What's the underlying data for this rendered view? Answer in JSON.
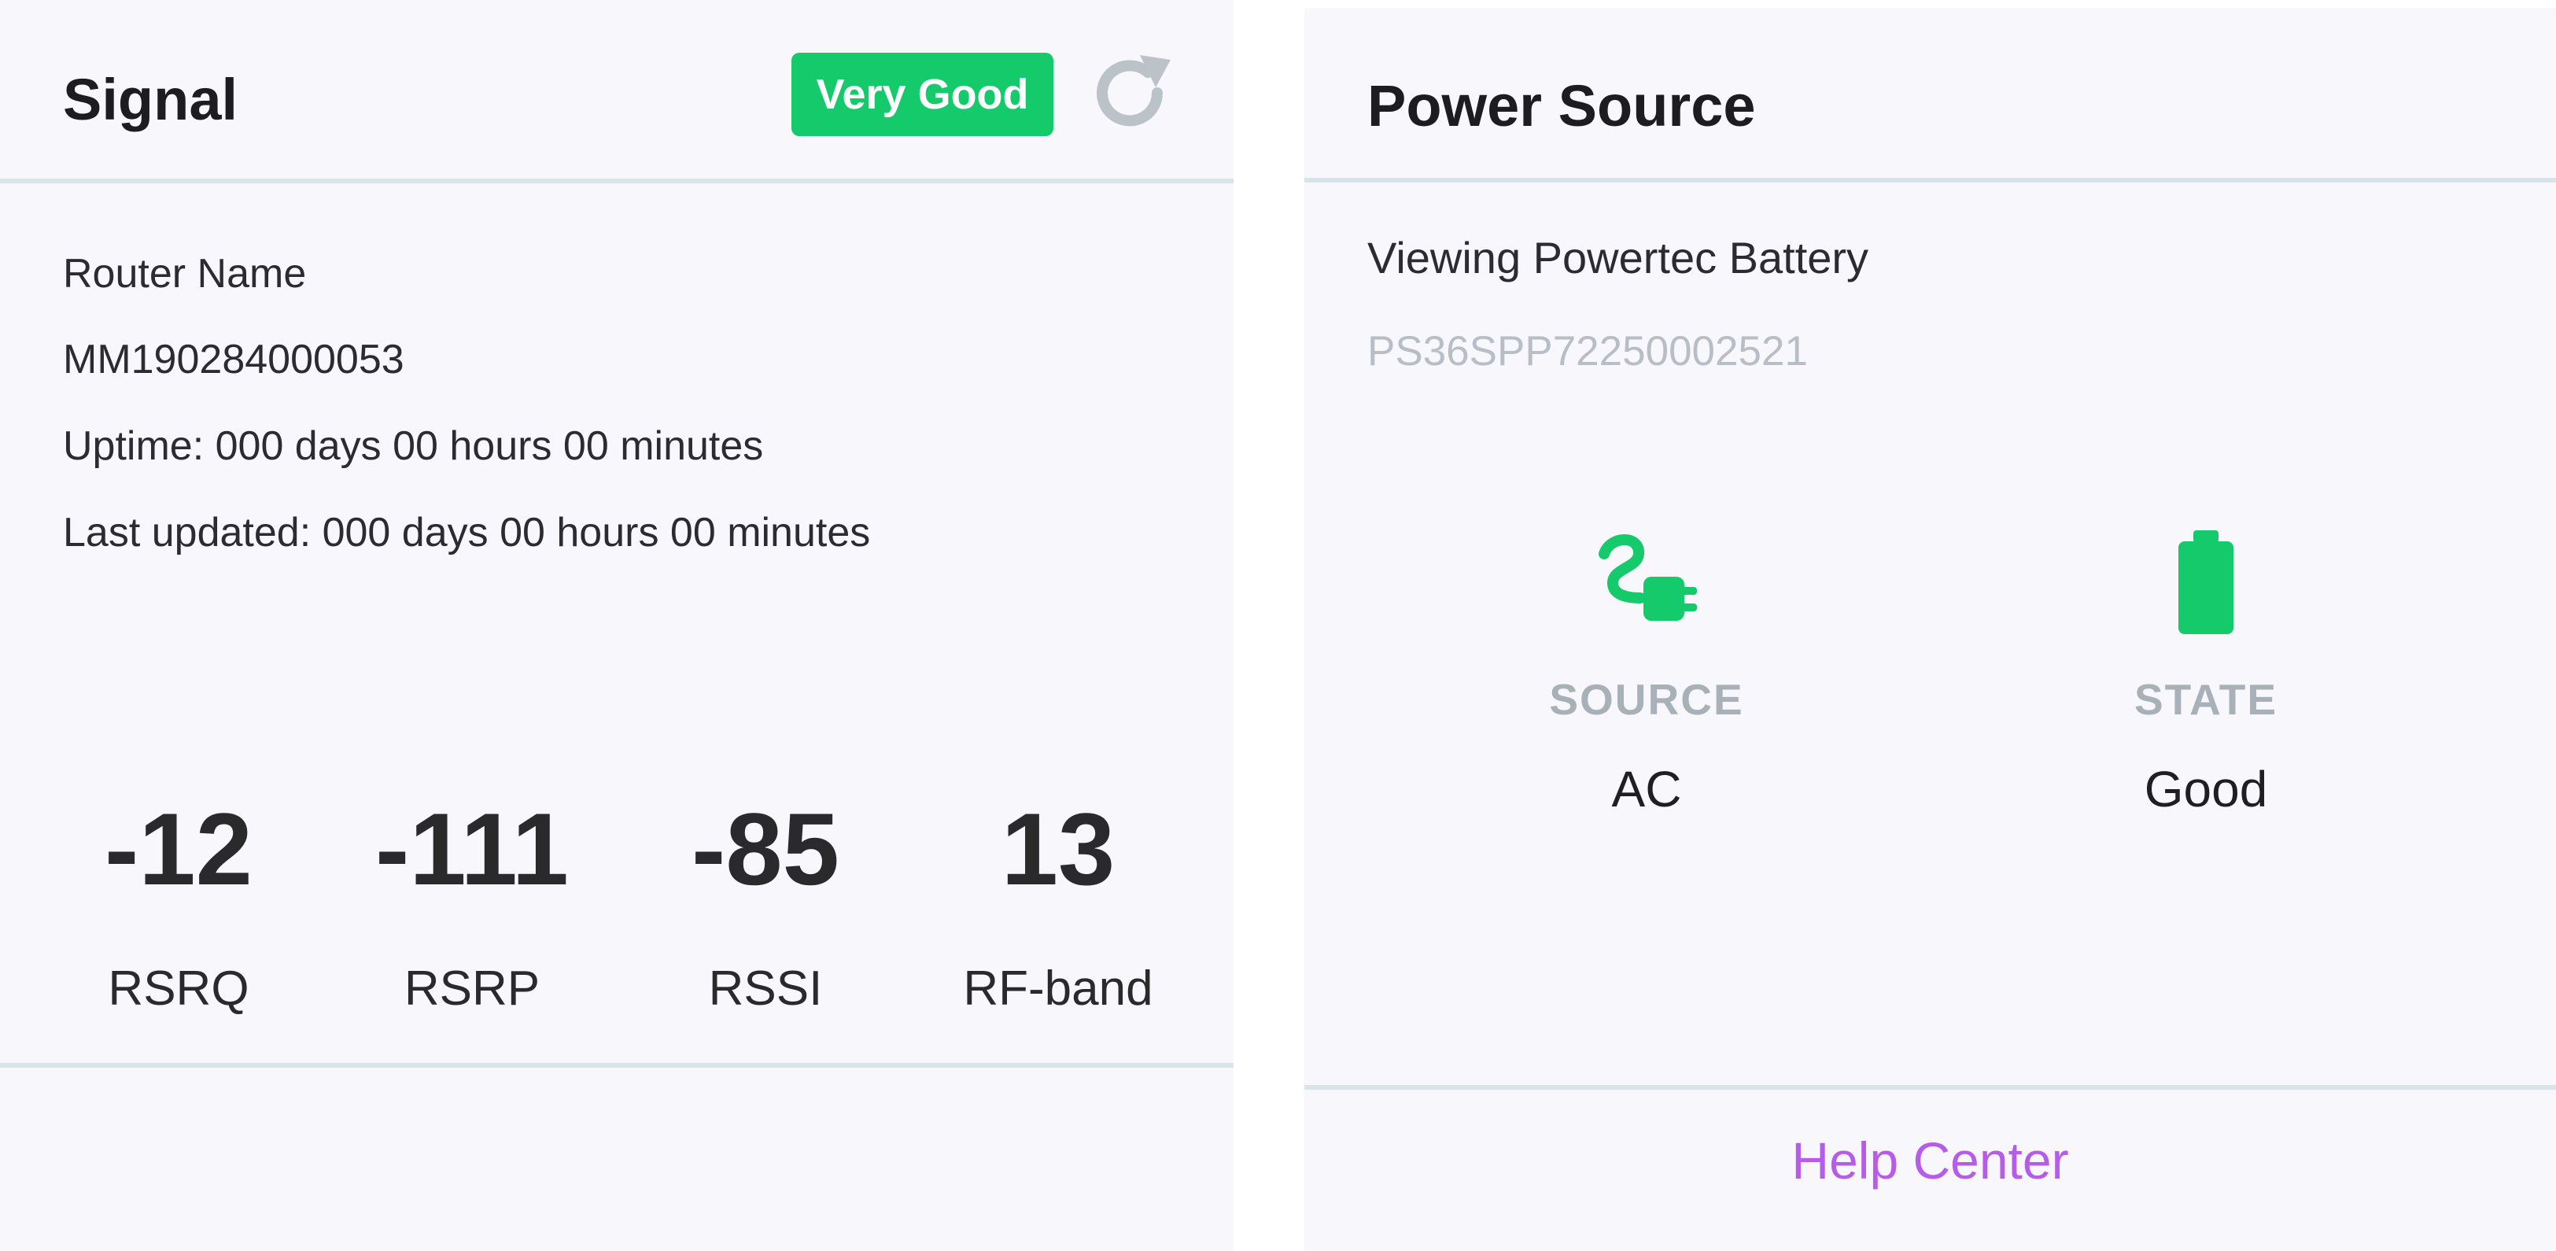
{
  "signal": {
    "title": "Signal",
    "badge": "Very Good",
    "router_name_label": "Router Name",
    "router_id": "MM190284000053",
    "uptime": "Uptime: 000 days 00 hours 00 minutes",
    "last_updated": "Last updated: 000 days 00 hours 00 minutes",
    "metrics": [
      {
        "value": "-12",
        "label": "RSRQ"
      },
      {
        "value": "-111",
        "label": "RSRP"
      },
      {
        "value": "-85",
        "label": "RSSI"
      },
      {
        "value": "13",
        "label": "RF-band"
      }
    ],
    "refresh_icon": "refresh-icon"
  },
  "power": {
    "title": "Power Source",
    "viewing": "Viewing Powertec Battery",
    "serial": "PS36SPP72250002521",
    "source": {
      "label": "SOURCE",
      "value": "AC",
      "icon": "plug-icon"
    },
    "state": {
      "label": "STATE",
      "value": "Good",
      "icon": "battery-icon"
    },
    "help_center": "Help Center"
  },
  "colors": {
    "accent_green": "#15ca6a",
    "link_purple": "#b75ce9",
    "muted_gray": "#a8b0b8",
    "divider": "#d8e4ea",
    "panel_bg": "#f7f7fc"
  }
}
